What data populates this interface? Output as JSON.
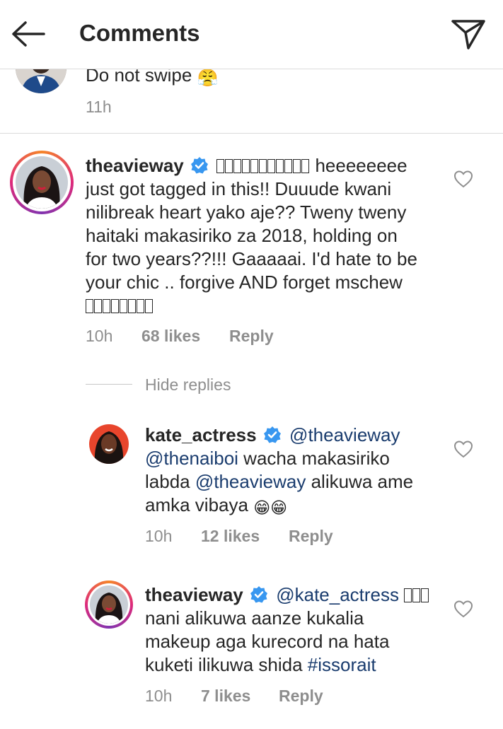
{
  "header": {
    "title": "Comments"
  },
  "prev_comment": {
    "text": "Do not swipe",
    "emoji": "😤",
    "time": "11h"
  },
  "comment1": {
    "username": "theavieway",
    "lines": [
      "heeeeeeee",
      "just got tagged in this!! Duuude kwani",
      "nilibreak heart yako aje?? Tweny tweny",
      "haitaki makasiriko za 2018, holding on",
      "for two years??!!! Gaaaaai. I'd hate to be",
      "your chic .. forgive AND forget mschew"
    ],
    "time": "10h",
    "likes": "68 likes",
    "reply": "Reply"
  },
  "hide_replies": "Hide replies",
  "reply1": {
    "username": "kate_actress",
    "mention1": "@theavieway",
    "mention2": "@thenaiboi",
    "text2": "wacha makasiriko",
    "text3a": "labda",
    "mention3": "@theavieway",
    "text3b": "alikuwa ame",
    "text4": "amka vibaya",
    "emoji": "😁😁",
    "time": "10h",
    "likes": "12 likes",
    "reply": "Reply"
  },
  "reply2": {
    "username": "theavieway",
    "mention1": "@kate_actress",
    "lines": [
      "nani alikuwa aanze kukalia",
      "makeup aga kurecord na hata",
      "kuketi ilikuwa shida"
    ],
    "hashtag": "#issorait",
    "time": "10h",
    "likes": "7 likes",
    "reply": "Reply"
  },
  "colors": {
    "link": "#1a3c6e",
    "muted": "#8e8e8e",
    "verified": "#3897f0"
  }
}
